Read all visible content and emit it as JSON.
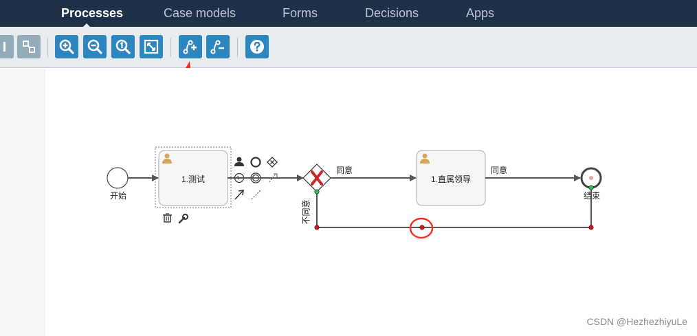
{
  "nav": {
    "items": [
      {
        "label": "Processes",
        "active": true
      },
      {
        "label": "Case models",
        "active": false
      },
      {
        "label": "Forms",
        "active": false
      },
      {
        "label": "Decisions",
        "active": false
      },
      {
        "label": "Apps",
        "active": false
      }
    ]
  },
  "toolbar": {
    "buttons": [
      {
        "name": "align-icon",
        "enabled": false
      },
      {
        "name": "group-icon",
        "enabled": false
      },
      {
        "name": "zoom-in-icon",
        "enabled": true
      },
      {
        "name": "zoom-out-icon",
        "enabled": true
      },
      {
        "name": "zoom-actual-icon",
        "enabled": true
      },
      {
        "name": "zoom-fit-icon",
        "enabled": true
      },
      {
        "name": "add-bendpoint-icon",
        "enabled": true
      },
      {
        "name": "remove-bendpoint-icon",
        "enabled": true
      },
      {
        "name": "help-icon",
        "enabled": true
      }
    ]
  },
  "diagram": {
    "start_label": "开始",
    "task1_label": "1.测试",
    "task2_label": "1.直属领导",
    "flow_agree1": "同意",
    "flow_agree2": "同意",
    "flow_disagree": "不同意",
    "end_label": "结束"
  },
  "colors": {
    "nav_bg": "#1f3149",
    "toolbar_bg": "#e8ecf0",
    "button": "#2e86c1",
    "annotation_red": "#ff2a1a",
    "gateway_x": "#c62828"
  },
  "watermark": "CSDN @HezhezhiyuLe"
}
